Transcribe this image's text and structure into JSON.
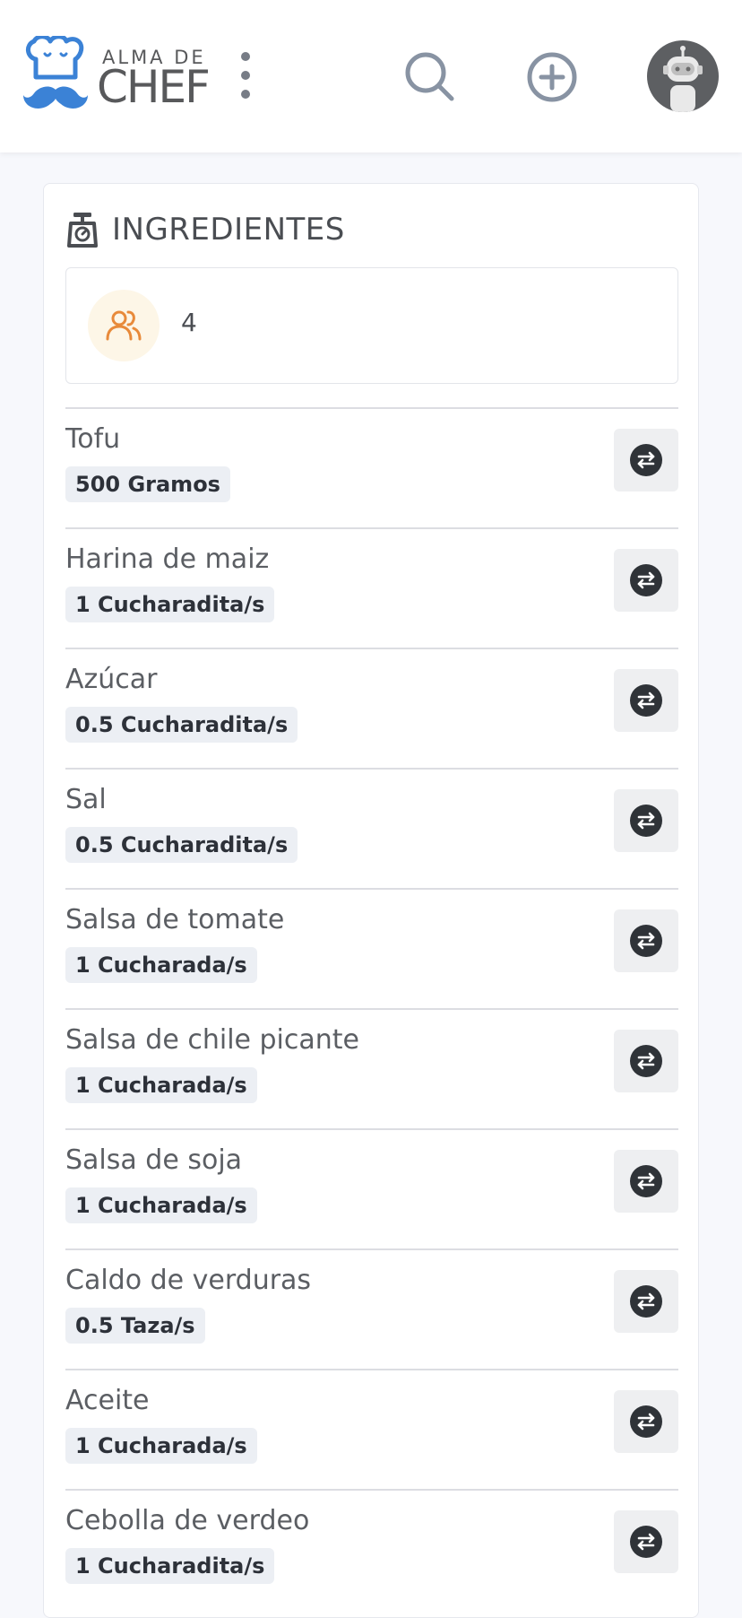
{
  "header": {
    "logo_small": "ALMA DE",
    "logo_big": "CHEF",
    "icons": {
      "logo": "chef-hat-mustache-icon",
      "menu": "kebab-menu-icon",
      "search": "search-icon",
      "add": "plus-circle-icon",
      "avatar": "robot-avatar"
    },
    "colors": {
      "logo_blue": "#3b82d6",
      "icon_gray": "#8893a3"
    }
  },
  "ingredients_card": {
    "title": "INGREDIENTES",
    "title_icon": "kitchen-scale-icon",
    "servings_icon": "users-icon",
    "servings_icon_color": "#e88a3a",
    "servings": "4",
    "swap_icon": "swap-arrows-icon",
    "items": [
      {
        "name": "Tofu",
        "quantity": "500 Gramos"
      },
      {
        "name": "Harina de maiz",
        "quantity": "1 Cucharadita/s"
      },
      {
        "name": "Azúcar",
        "quantity": "0.5 Cucharadita/s"
      },
      {
        "name": "Sal",
        "quantity": "0.5 Cucharadita/s"
      },
      {
        "name": "Salsa de tomate",
        "quantity": "1 Cucharada/s"
      },
      {
        "name": "Salsa de chile picante",
        "quantity": "1 Cucharada/s"
      },
      {
        "name": "Salsa de soja",
        "quantity": "1 Cucharada/s"
      },
      {
        "name": "Caldo de verduras",
        "quantity": "0.5 Taza/s"
      },
      {
        "name": "Aceite",
        "quantity": "1 Cucharada/s"
      },
      {
        "name": "Cebolla de verdeo",
        "quantity": "1 Cucharadita/s"
      }
    ]
  }
}
